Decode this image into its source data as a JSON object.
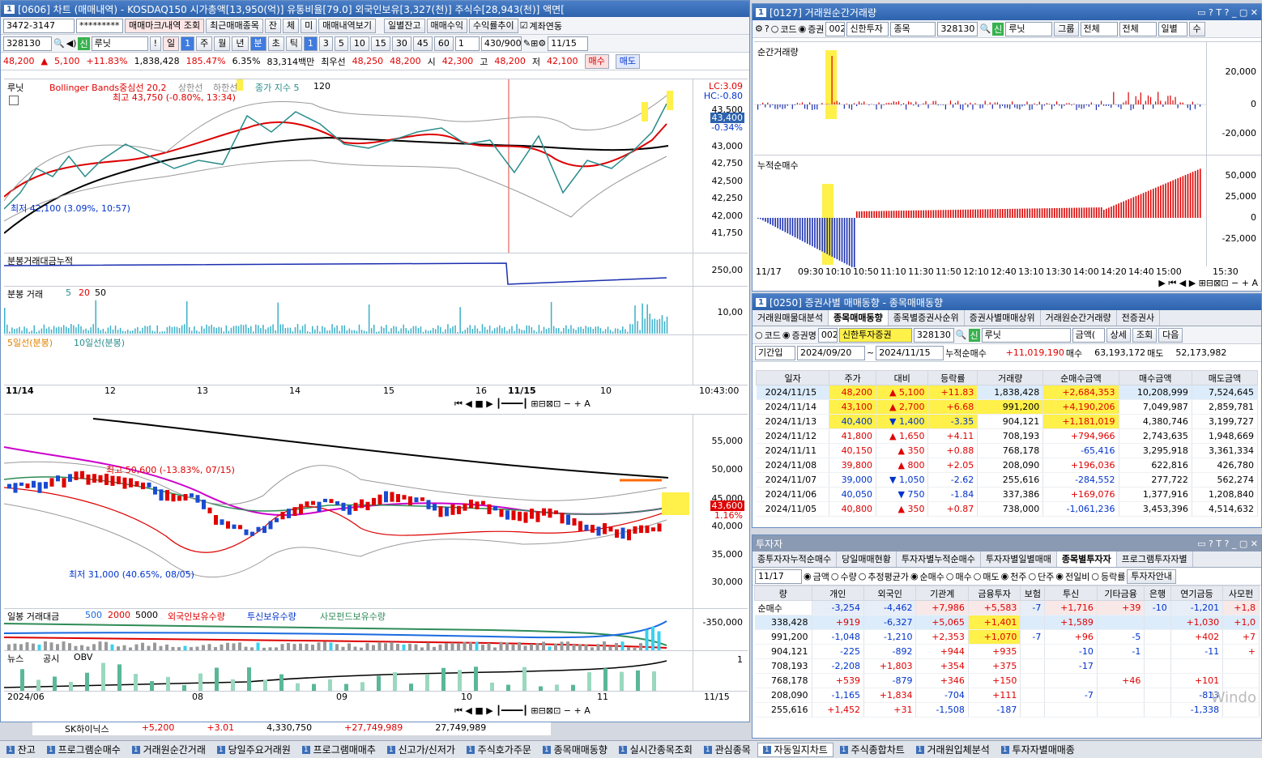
{
  "chartwin": {
    "title": "[0606] 차트 (매매내역) - KOSDAQ150 시가총액[13,950(억)] 유통비율[79.0] 외국인보유[3,327(천)] 주식수[28,943(천)] 액면[",
    "account": "3472-3147",
    "password": "*********",
    "buttons": [
      "매매마크/내역 조회",
      "최근매매종목",
      "잔",
      "체",
      "미",
      "매매내역보기",
      "일별잔고",
      "매매수익",
      "수익률추이"
    ],
    "account_link": "계좌연동",
    "code": "328130",
    "credit": "신",
    "name": "루닛",
    "periods": [
      "일",
      "1",
      "주",
      "월",
      "년",
      "분",
      "초",
      "틱"
    ],
    "minutes": [
      "1",
      "3",
      "5",
      "10",
      "15",
      "30",
      "45",
      "60"
    ],
    "count": "430/900",
    "date": "11/15",
    "quote": {
      "price": "48,200",
      "arrow": "▲",
      "change": "5,100",
      "pct": "+11.83%",
      "volume": "1,838,428",
      "volratio": "185.47%",
      "turn": "6.35%",
      "amount": "83,314백만",
      "best_label": "최우선",
      "best": "48,250",
      "best2": "48,200",
      "open_l": "시",
      "open": "42,300",
      "high_l": "고",
      "high": "48,200",
      "low_l": "저",
      "low": "42,100",
      "buy": "매수",
      "sell": "매도"
    },
    "top_chart": {
      "legend1": "루닛",
      "legend2": "Bollinger Bands중심선 20,2",
      "legend3": "상한선",
      "legend4": "하한선",
      "legend5": "종가 지수 5",
      "legend6": "120",
      "high_note": "최고 43,750 (-0.80%, 13:34)",
      "low_note": "최저 42,100 (3.09%, 10:57)",
      "lc": "LC:3.09",
      "hc": "HC:-0.80",
      "cur": "43,400",
      "curpct": "-0.34%",
      "ticks": [
        "43,500",
        "43,250",
        "43,000",
        "42,750",
        "42,500",
        "42,250",
        "42,000",
        "41,750"
      ],
      "p2": "분봉거래대금누적",
      "p2tick": "250,00",
      "p3": "분봉 거래",
      "p3a": "5",
      "p3b": "20",
      "p3c": "50",
      "p3tick": "10,00",
      "p4a": "5일선(분봉)",
      "p4b": "10일선(분봉)",
      "xlabels": [
        "11/14",
        "12",
        "13",
        "14",
        "15",
        "16",
        "11/15",
        "10"
      ],
      "time": "10:43:00"
    },
    "bottom_chart": {
      "high_note": "최고 50,600 (-13.83%, 07/15)",
      "low_note": "최저 31,000 (40.65%, 08/05)",
      "ticks": [
        "55,000",
        "50,000",
        "45,000",
        "40,000",
        "35,000",
        "30,000"
      ],
      "cur": "43,600",
      "curpct": "1.16%",
      "p2a": "일봉 거래대금",
      "p2b": "500",
      "p2c": "2000",
      "p2d": "5000",
      "p2e": "외국인보유수량",
      "p2f": "투신보유수량",
      "p2g": "사모펀드보유수량",
      "p2tick": "-350,000",
      "p3a": "뉴스",
      "p3b": "공시",
      "p3c": "OBV",
      "p3tick": "1",
      "xlabels": [
        "2024/06",
        "08",
        "09",
        "10",
        "11",
        "11/15"
      ]
    }
  },
  "tickwin": {
    "title": "[0127] 거래원순간거래량",
    "code_opt": "코드",
    "stock_opt": "증권",
    "broker_no": "002",
    "broker": "신한투자",
    "kind": "종목",
    "code": "328130",
    "name": "루닛",
    "group": "그룹",
    "all1": "전체",
    "all2": "전체",
    "daily": "일별",
    "count": "수",
    "p1": "순간거래량",
    "p1ticks": [
      "20,000",
      "0",
      "-20,000"
    ],
    "p2": "누적순매수",
    "p2ticks": [
      "50,000",
      "25,000",
      "0",
      "-25,000"
    ],
    "xlabels": [
      "11/17",
      "09:30",
      "10:10",
      "10:50",
      "11:10",
      "11:30",
      "11:50",
      "12:10",
      "12:40",
      "13:10",
      "13:30",
      "14:00",
      "14:20",
      "14:40",
      "15:00",
      "15:30"
    ]
  },
  "trendwin": {
    "title": "[0250] 증권사별 매매동향 - 종목매매동향",
    "tabs": [
      "거래원매물대분석",
      "종목매매동향",
      "종목별증권사순위",
      "증권사별매매상위",
      "거래원순간거래량",
      "전증권사"
    ],
    "code_opt": "코드",
    "broker_opt": "증권명",
    "broker_no": "002",
    "broker": "신한투자증권",
    "code": "328130",
    "credit": "신",
    "name": "루닛",
    "amount": "금액(",
    "detail": "상세",
    "query": "조회",
    "next": "다음",
    "period": "기간입",
    "from": "2024/09/20",
    "to": "2024/11/15",
    "cum_label": "누적순매수",
    "cum": "+11,019,190",
    "buy_label": "매수",
    "buy": "63,193,172",
    "sell_label": "매도",
    "sell": "52,173,982",
    "headers": [
      "일자",
      "주가",
      "대비",
      "등락률",
      "거래량",
      "순매수금액",
      "매수금액",
      "매도금액"
    ],
    "rows": [
      [
        "2024/11/15",
        "48,200",
        "▲",
        "5,100",
        "+11.83",
        "1,838,428",
        "+2,684,353",
        "10,208,999",
        "7,524,645"
      ],
      [
        "2024/11/14",
        "43,100",
        "▲",
        "2,700",
        "+6.68",
        "991,200",
        "+4,190,206",
        "7,049,987",
        "2,859,781"
      ],
      [
        "2024/11/13",
        "40,400",
        "▼",
        "1,400",
        "-3.35",
        "904,121",
        "+1,181,019",
        "4,380,746",
        "3,199,727"
      ],
      [
        "2024/11/12",
        "41,800",
        "▲",
        "1,650",
        "+4.11",
        "708,193",
        "+794,966",
        "2,743,635",
        "1,948,669"
      ],
      [
        "2024/11/11",
        "40,150",
        "▲",
        "350",
        "+0.88",
        "768,178",
        "-65,416",
        "3,295,918",
        "3,361,334"
      ],
      [
        "2024/11/08",
        "39,800",
        "▲",
        "800",
        "+2.05",
        "208,090",
        "+196,036",
        "622,816",
        "426,780"
      ],
      [
        "2024/11/07",
        "39,000",
        "▼",
        "1,050",
        "-2.62",
        "255,616",
        "-284,552",
        "277,722",
        "562,274"
      ],
      [
        "2024/11/06",
        "40,050",
        "▼",
        "750",
        "-1.84",
        "337,386",
        "+169,076",
        "1,377,916",
        "1,208,840"
      ],
      [
        "2024/11/05",
        "40,800",
        "▲",
        "350",
        "+0.87",
        "738,000",
        "-1,061,236",
        "3,453,396",
        "4,514,632"
      ]
    ]
  },
  "investwin": {
    "title": "투자자",
    "tabs": [
      "종투자자누적순매수",
      "당일매매현황",
      "투자자별누적순매수",
      "투자자별일별매매",
      "종목별투자자",
      "프로그램투자자별"
    ],
    "date": "11/17",
    "opt1": [
      "금액",
      "수량",
      "추정평균가"
    ],
    "opt2": [
      "순매수",
      "매수",
      "매도"
    ],
    "opt3": [
      "천주",
      "단주"
    ],
    "opt4": [
      "전일비",
      "등락률"
    ],
    "btn": "투자자안내",
    "sum_label": "순매수",
    "sum": [
      "-3,254",
      "-4,462",
      "+7,986",
      "+5,583",
      "-7",
      "+1,716",
      "+39",
      "-10",
      "-1,201",
      "+1,8"
    ],
    "headers": [
      "량",
      "개인",
      "외국인",
      "기관계",
      "금융투자",
      "보험",
      "투신",
      "기타금융",
      "은행",
      "연기금등",
      "사모펀"
    ],
    "rows": [
      [
        "338,428",
        "+919",
        "-6,327",
        "+5,065",
        "+1,401",
        "",
        "+1,589",
        "",
        "",
        "+1,030",
        "+1,0"
      ],
      [
        "991,200",
        "-1,048",
        "-1,210",
        "+2,353",
        "+1,070",
        "-7",
        "+96",
        "-5",
        "",
        "+402",
        "+7"
      ],
      [
        "904,121",
        "-225",
        "-892",
        "+944",
        "+935",
        "",
        "-10",
        "-1",
        "",
        "-11",
        "+"
      ],
      [
        "708,193",
        "-2,208",
        "+1,803",
        "+354",
        "+375",
        "",
        "-17",
        "",
        "",
        "",
        ""
      ],
      [
        "768,178",
        "+539",
        "-879",
        "+346",
        "+150",
        "",
        "",
        "+46",
        "",
        "+101",
        ""
      ],
      [
        "208,090",
        "-1,165",
        "+1,834",
        "-704",
        "+111",
        "",
        "-7",
        "",
        "",
        "-813",
        ""
      ],
      [
        "255,616",
        "+1,452",
        "+31",
        "-1,508",
        "-187",
        "",
        "",
        "",
        "",
        "-1,338",
        ""
      ]
    ],
    "watermark": "Windo"
  },
  "balance_row": {
    "name": "SK하이닉스",
    "change": "+5,200",
    "pct": "+3.01",
    "qty": "4,330,750",
    "amt": "+27,749,989",
    "amt2": "27,749,989"
  },
  "taskbar": [
    "잔고",
    "프로그램순매수",
    "거래원순간거래",
    "당일주요거래원",
    "프로그램매매추",
    "신고가/신저가",
    "주식호가주문",
    "종목매매동향",
    "실시간종목조회",
    "관심종목",
    "자동일지차트",
    "주식종합차트",
    "거래원입체분석",
    "투자자별매매종"
  ],
  "colors": {
    "up": "#e00000",
    "down": "#0033cc",
    "highlight": "#fff04a",
    "accent": "#2d63ad"
  }
}
